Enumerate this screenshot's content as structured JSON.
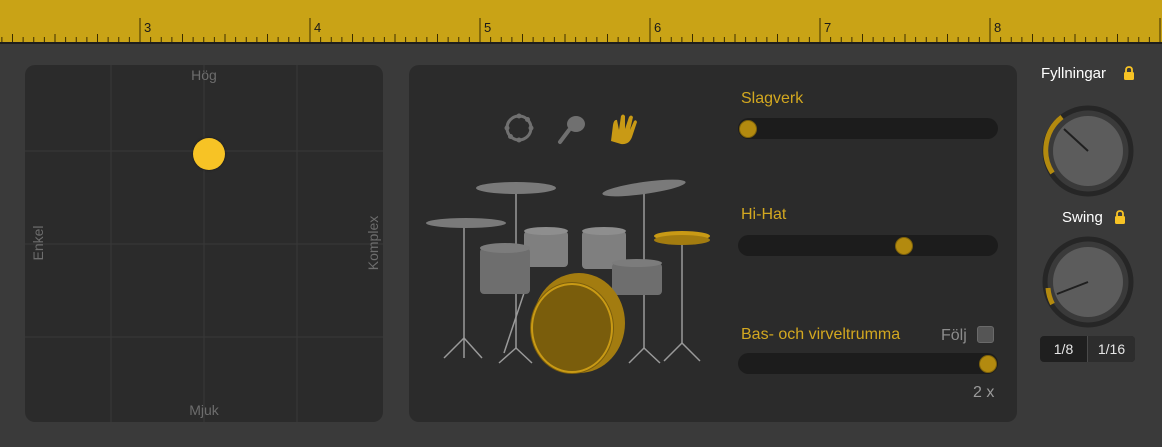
{
  "ruler": {
    "bar_numbers": [
      "3",
      "4",
      "5",
      "6",
      "7",
      "8"
    ]
  },
  "xy_pad": {
    "top_label": "Hög",
    "bottom_label": "Mjuk",
    "left_label": "Enkel",
    "right_label": "Komplex"
  },
  "kit": {
    "instrument_icons": [
      "tambourine-icon",
      "shaker-icon",
      "clap-icon"
    ],
    "active_instrument": "clap-icon",
    "percussion": {
      "label": "Slagverk",
      "value": 0.0
    },
    "hihat": {
      "label": "Hi-Hat",
      "value": 0.65
    },
    "kick_snare": {
      "label": "Bas- och virveltrumma",
      "value": 1.0,
      "follow_label": "Följ",
      "follow_checked": false
    },
    "multiplier": "2 x"
  },
  "controls": {
    "fills": {
      "label": "Fyllningar",
      "locked": true
    },
    "swing": {
      "label": "Swing",
      "locked": true
    },
    "resolution": {
      "options": [
        "1/8",
        "1/16"
      ],
      "selected": "1/16"
    }
  },
  "colors": {
    "accent": "#d3a820",
    "ruler": "#c9a316",
    "puck": "#f7c325",
    "background": "#3a3a3a",
    "panel": "#2b2b2b"
  }
}
